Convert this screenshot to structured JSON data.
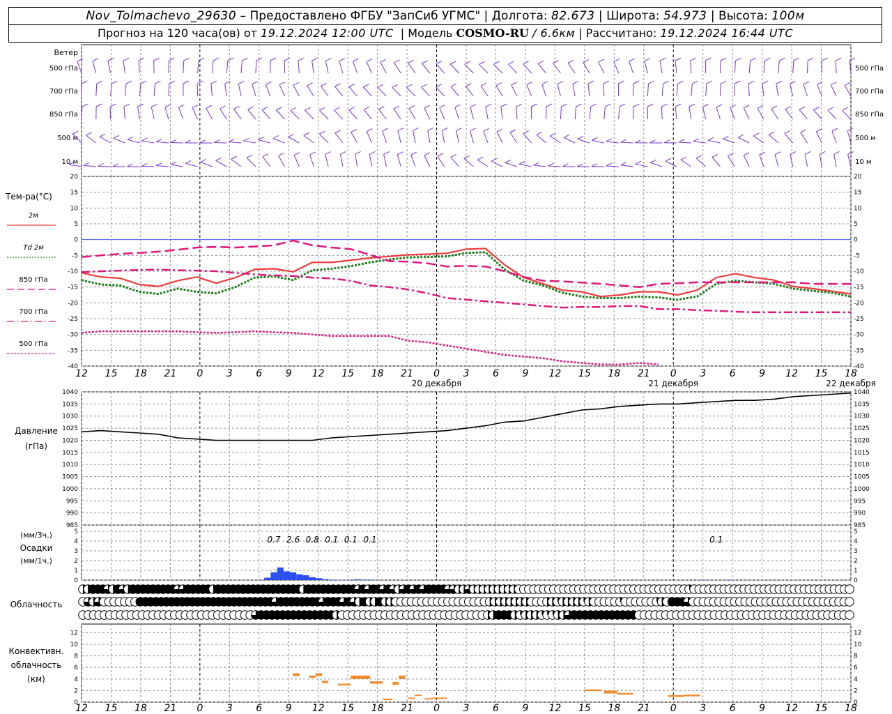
{
  "header": {
    "station": "Nov_Tolmachevo_29630",
    "dash": "–",
    "provider": "Предоставлено ФГБУ \"ЗапСиб УГМС\"",
    "lon_label": "Долгота:",
    "lon_value": "82.673",
    "lat_label": "Широта:",
    "lat_value": "54.973",
    "height_label": "Высота:",
    "height_value": "100м",
    "forecast_label": "Прогноз на 120 часа(ов) от",
    "forecast_start": "19.12.2024 12:00 UTC",
    "model_label": "Модель",
    "model_name": "COSMO-RU",
    "model_res": "/ 6.6км",
    "calc_label": "Рассчитано:",
    "calc_time": "19.12.2024 16:44 UTC"
  },
  "time_axis": {
    "hour_labels": [
      "12",
      "15",
      "18",
      "21",
      "0",
      "3",
      "6",
      "9",
      "12",
      "15",
      "18",
      "21",
      "0",
      "3",
      "6",
      "9",
      "12",
      "15",
      "18",
      "21",
      "0",
      "3",
      "6",
      "9",
      "12",
      "15",
      "18"
    ],
    "day_labels": [
      {
        "label": "20 декабря",
        "hour_index": 12
      },
      {
        "label": "21 декабря",
        "hour_index": 20
      },
      {
        "label": "22 декабря",
        "hour_index": 26
      }
    ]
  },
  "colors": {
    "wind": "#7a2fd0",
    "t2m": "#ee3a3a",
    "td2m": "#1a7a1a",
    "t850": "#e0157e",
    "t700": "#e0157e",
    "t500": "#e0157e",
    "pressure": "#000000",
    "precip": "#2b4ef5",
    "convective": "#f08c30",
    "zero_line": "#4a64ff",
    "grid": "#909090"
  },
  "wind_panel": {
    "title": "Ветер",
    "levels": [
      "500 гПа",
      "700 гПа",
      "850 гПа",
      "500 м",
      "10  м"
    ]
  },
  "temp_panel": {
    "title": "Тем-ра(°C)",
    "legend": [
      {
        "label": "2м",
        "style": "solid"
      },
      {
        "label": "Td  2м",
        "style": "dotted"
      },
      {
        "label": "850 гПа",
        "style": "dash"
      },
      {
        "label": "700 гПа",
        "style": "dashdot"
      },
      {
        "label": "500 гПа",
        "style": "dot"
      }
    ],
    "ylim": [
      -40,
      20
    ],
    "ticks": [
      20,
      15,
      10,
      5,
      0,
      -5,
      -10,
      -15,
      -20,
      -25,
      -30,
      -35,
      -40
    ]
  },
  "pressure_panel": {
    "title": "Давление",
    "unit": "(гПа)",
    "ylim": [
      985,
      1040
    ],
    "ticks": [
      1040,
      1035,
      1030,
      1025,
      1020,
      1015,
      1010,
      1005,
      1000,
      995,
      990,
      985
    ]
  },
  "precip_panel": {
    "unit3h": "(мм/3ч.)",
    "title": "Осадки",
    "unit1h": "(мм/1ч.)",
    "ylim": [
      0,
      5
    ],
    "ticks": [
      5,
      4,
      3,
      2,
      1,
      0
    ],
    "totals": [
      {
        "hour": 30,
        "value": "0.7"
      },
      {
        "hour": 33,
        "value": "2.6"
      },
      {
        "hour": 36,
        "value": "0.8"
      },
      {
        "hour": 39,
        "value": "0.1"
      },
      {
        "hour": 42,
        "value": "0.1"
      },
      {
        "hour": 45,
        "value": "0.1"
      },
      {
        "hour": 99,
        "value": "0.1"
      }
    ]
  },
  "cloud_panel": {
    "title": "Облачность"
  },
  "conv_panel": {
    "title_line1": "Конвективн.",
    "title_line2": "облачность",
    "unit": "(км)",
    "ylim": [
      0,
      13
    ],
    "ticks": [
      12,
      10,
      8,
      6,
      4,
      2,
      0
    ]
  },
  "chart_data": [
    {
      "type": "line",
      "title": "Тем-ра(°C)",
      "x_hours": [
        0,
        3,
        6,
        9,
        12,
        15,
        18,
        21,
        24,
        27,
        30,
        33,
        36,
        39,
        42,
        45,
        48,
        51,
        54,
        57,
        60,
        63,
        66,
        69,
        72,
        75,
        78,
        81,
        84,
        87,
        90,
        93,
        96,
        99,
        102,
        105,
        108,
        111,
        114,
        117,
        120
      ],
      "series": [
        {
          "name": "2м",
          "values": [
            -10.5,
            -11.8,
            -12.2,
            -14.2,
            -14.8,
            -13.0,
            -11.8,
            -13.8,
            -12.0,
            -9.4,
            -9.2,
            -10.2,
            -7.2,
            -7.2,
            -6.5,
            -5.8,
            -5.3,
            -4.8,
            -4.6,
            -4.3,
            -3.0,
            -2.8,
            -8.0,
            -12.0,
            -14.0,
            -16.0,
            -16.5,
            -18.0,
            -17.5,
            -16.5,
            -16.5,
            -17.5,
            -16.0,
            -12.0,
            -10.8,
            -12.0,
            -12.8,
            -14.8,
            -15.5,
            -16.3,
            -17.2
          ]
        },
        {
          "name": "Td  2м",
          "values": [
            -12.8,
            -14.2,
            -14.5,
            -16.5,
            -17.2,
            -15.5,
            -16.5,
            -17.0,
            -15.0,
            -12.0,
            -11.6,
            -12.8,
            -9.7,
            -9.2,
            -8.4,
            -7.2,
            -6.3,
            -5.6,
            -5.5,
            -5.3,
            -4.2,
            -4.0,
            -9.5,
            -13.0,
            -14.5,
            -16.8,
            -18.0,
            -18.5,
            -18.5,
            -18.0,
            -18.3,
            -19.0,
            -18.0,
            -14.0,
            -13.0,
            -13.5,
            -14.0,
            -15.5,
            -16.2,
            -16.8,
            -18.0
          ]
        },
        {
          "name": "850 гПа",
          "values": [
            -5.5,
            -5.0,
            -4.5,
            -4.2,
            -3.8,
            -3.2,
            -2.5,
            -2.3,
            -2.5,
            -2.2,
            -1.8,
            -0.3,
            -1.8,
            -2.5,
            -3.0,
            -4.8,
            -6.8,
            -7.0,
            -7.5,
            -8.5,
            -8.3,
            -8.5,
            -10.0,
            -11.8,
            -13.0,
            -13.2,
            -13.6,
            -14.0,
            -14.5,
            -15.0,
            -14.0,
            -13.8,
            -13.5,
            -13.5,
            -13.5,
            -13.5,
            -13.5,
            -13.5,
            -14.0,
            -14.0,
            -14.0
          ]
        },
        {
          "name": "700 гПа",
          "values": [
            -10.3,
            -10.0,
            -9.8,
            -9.6,
            -9.5,
            -9.7,
            -9.8,
            -10.0,
            -10.5,
            -11.0,
            -11.3,
            -11.5,
            -12.0,
            -12.3,
            -13.0,
            -14.5,
            -15.0,
            -15.8,
            -17.0,
            -18.5,
            -19.0,
            -19.5,
            -20.0,
            -20.5,
            -21.0,
            -21.5,
            -21.3,
            -21.3,
            -21.0,
            -21.0,
            -22.0,
            -22.0,
            -22.3,
            -22.5,
            -22.8,
            -23.0,
            -23.0,
            -23.0,
            -23.0,
            -23.0,
            -23.0
          ]
        },
        {
          "name": "500 гПа",
          "values": [
            -29.5,
            -29.0,
            -29.0,
            -29.0,
            -29.0,
            -29.0,
            -29.3,
            -29.5,
            -29.3,
            -29.0,
            -29.3,
            -29.5,
            -30.0,
            -30.5,
            -30.5,
            -30.5,
            -30.5,
            -32.0,
            -32.5,
            -33.5,
            -34.5,
            -35.5,
            -36.5,
            -37.0,
            -37.5,
            -38.5,
            -39.0,
            -39.5,
            -39.5,
            -39.0,
            -39.5,
            -40.5,
            -41.0,
            -41.0,
            -41.0,
            -41.0,
            -41.0,
            -41.0,
            -41.0,
            -41.0,
            -41.0
          ]
        }
      ]
    },
    {
      "type": "line",
      "title": "Давление",
      "ylabel": "(гПа)",
      "x_hours": [
        0,
        3,
        6,
        9,
        12,
        15,
        18,
        21,
        24,
        27,
        30,
        33,
        36,
        39,
        42,
        45,
        48,
        51,
        54,
        57,
        60,
        63,
        66,
        69,
        72,
        75,
        78,
        81,
        84,
        87,
        90,
        93,
        96,
        99,
        102,
        105,
        108,
        111,
        114,
        117,
        120
      ],
      "series": [
        {
          "name": "Давление",
          "values": [
            1023.5,
            1024.0,
            1023.5,
            1023.0,
            1022.5,
            1021.0,
            1020.5,
            1020.0,
            1020.0,
            1020.0,
            1020.0,
            1020.0,
            1020.0,
            1021.0,
            1021.5,
            1022.0,
            1022.5,
            1023.0,
            1023.5,
            1024.0,
            1025.0,
            1026.0,
            1027.5,
            1028.0,
            1029.5,
            1031.0,
            1032.5,
            1033.0,
            1034.0,
            1034.5,
            1035.0,
            1035.0,
            1035.5,
            1036.0,
            1036.5,
            1036.5,
            1037.0,
            1038.0,
            1038.5,
            1039.0,
            1039.5
          ]
        }
      ]
    },
    {
      "type": "bar",
      "title": "Осадки",
      "ylabel": "(мм/1ч.)",
      "x_hours": [
        28,
        29,
        30,
        31,
        32,
        33,
        34,
        35,
        36,
        37,
        38,
        39,
        40,
        41,
        42,
        43,
        44,
        45,
        46,
        97,
        101
      ],
      "values": [
        0.05,
        0.25,
        0.8,
        1.3,
        0.9,
        0.8,
        0.6,
        0.5,
        0.3,
        0.2,
        0.1,
        0.05,
        0.03,
        0.02,
        0.05,
        0.08,
        0.05,
        0.05,
        0.02,
        0.05,
        0.05
      ]
    },
    {
      "type": "table",
      "title": "Облачность",
      "layers_octas": [
        [
          4,
          4,
          8,
          8,
          8,
          6,
          4,
          8,
          6,
          4,
          8,
          8,
          8,
          8,
          8,
          8,
          8,
          8,
          8,
          6,
          6,
          8,
          8,
          8,
          8,
          8,
          4,
          8,
          8,
          8,
          8,
          8,
          8,
          8,
          8,
          8,
          8,
          8,
          8,
          8,
          8,
          8,
          8,
          8,
          4,
          8,
          8,
          8,
          8,
          8,
          8,
          8,
          8,
          8,
          8,
          6,
          8,
          6,
          8,
          8,
          6,
          8,
          6,
          4,
          6,
          8,
          6,
          8,
          6,
          8,
          8,
          8,
          8,
          6,
          6,
          4,
          4,
          6,
          4,
          4,
          4,
          4,
          4,
          4,
          4,
          4,
          4,
          0,
          0,
          0,
          0,
          0,
          0,
          0,
          0,
          0,
          0,
          0,
          0,
          0,
          0,
          0,
          0,
          0,
          0,
          0,
          0,
          0,
          0,
          0,
          0,
          0,
          0,
          0,
          0,
          0,
          0,
          0,
          0,
          0,
          0,
          2,
          0,
          0,
          0,
          0,
          0,
          0,
          0,
          0,
          0,
          0,
          0,
          0,
          0,
          0,
          0,
          0,
          0,
          0,
          0,
          0,
          0,
          0,
          0,
          0,
          0,
          0,
          0,
          0,
          0,
          0,
          0,
          0
        ],
        [
          0,
          6,
          4,
          6,
          0,
          0,
          0,
          0,
          0,
          0,
          0,
          8,
          8,
          8,
          8,
          8,
          8,
          8,
          8,
          8,
          8,
          8,
          8,
          8,
          8,
          8,
          8,
          8,
          8,
          8,
          8,
          8,
          8,
          8,
          8,
          8,
          8,
          6,
          8,
          8,
          8,
          8,
          8,
          8,
          8,
          8,
          6,
          8,
          8,
          8,
          6,
          8,
          6,
          4,
          8,
          4,
          4,
          8,
          4,
          4,
          0,
          0,
          0,
          0,
          0,
          0,
          0,
          0,
          0,
          0,
          0,
          0,
          0,
          0,
          0,
          0,
          0,
          0,
          4,
          4,
          4,
          4,
          4,
          4,
          4,
          4,
          0,
          0,
          0,
          4,
          4,
          2,
          4,
          4,
          4,
          4,
          2,
          4,
          0,
          0,
          0,
          0,
          0,
          2,
          0,
          0,
          0,
          0,
          0,
          0,
          2,
          4,
          0,
          8,
          8,
          8,
          6,
          0,
          0,
          0,
          0,
          0,
          0,
          0,
          0,
          0,
          0,
          0,
          0,
          0,
          0,
          0,
          0,
          0,
          0,
          0,
          0,
          0,
          0,
          0,
          0,
          0,
          0,
          0,
          0,
          0,
          0,
          0
        ],
        [
          0,
          0,
          0,
          0,
          0,
          0,
          0,
          0,
          0,
          0,
          0,
          0,
          0,
          0,
          0,
          0,
          0,
          0,
          0,
          0,
          0,
          0,
          0,
          0,
          0,
          0,
          0,
          0,
          0,
          0,
          0,
          0,
          6,
          8,
          8,
          8,
          8,
          8,
          8,
          8,
          8,
          8,
          8,
          8,
          8,
          8,
          8,
          4,
          0,
          0,
          0,
          0,
          0,
          0,
          0,
          0,
          0,
          0,
          0,
          0,
          0,
          0,
          0,
          0,
          0,
          0,
          0,
          0,
          0,
          0,
          0,
          0,
          0,
          0,
          0,
          4,
          4,
          8,
          8,
          8,
          4,
          2,
          4,
          4,
          4,
          2,
          2,
          2,
          4,
          4,
          6,
          8,
          8,
          8,
          8,
          8,
          8,
          8,
          8,
          8,
          8,
          8,
          8,
          0,
          0,
          0,
          0,
          0,
          0,
          0,
          0,
          0,
          0,
          0,
          0,
          0,
          0,
          0,
          0,
          0,
          0,
          0,
          0,
          0,
          0,
          0,
          0,
          0,
          0,
          0,
          0,
          0,
          0,
          0,
          0,
          0,
          0,
          0,
          0,
          0,
          0,
          0,
          0
        ]
      ]
    },
    {
      "type": "bar",
      "title": "Конвективн. облачность",
      "ylabel": "(км)",
      "segments": [
        {
          "x0": 33.0,
          "x1": 34.0,
          "bottom": 4.5,
          "top": 5.0
        },
        {
          "x0": 35.5,
          "x1": 36.5,
          "bottom": 4.2,
          "top": 4.6
        },
        {
          "x0": 36.5,
          "x1": 37.5,
          "bottom": 4.5,
          "top": 5.0
        },
        {
          "x0": 37.5,
          "x1": 38.5,
          "bottom": 3.3,
          "top": 3.7
        },
        {
          "x0": 40.0,
          "x1": 42.0,
          "bottom": 2.9,
          "top": 3.2
        },
        {
          "x0": 42.0,
          "x1": 43.0,
          "bottom": 4.0,
          "top": 4.6
        },
        {
          "x0": 43.0,
          "x1": 45.0,
          "bottom": 4.0,
          "top": 4.6
        },
        {
          "x0": 45.0,
          "x1": 47.0,
          "bottom": 3.2,
          "top": 3.6
        },
        {
          "x0": 47.0,
          "x1": 48.5,
          "bottom": 0.5,
          "top": 0.6
        },
        {
          "x0": 48.5,
          "x1": 49.5,
          "bottom": 3.0,
          "top": 3.5
        },
        {
          "x0": 49.5,
          "x1": 50.5,
          "bottom": 4.0,
          "top": 4.6
        },
        {
          "x0": 51.0,
          "x1": 52.0,
          "bottom": 0.7,
          "top": 0.8
        },
        {
          "x0": 52.0,
          "x1": 53.0,
          "bottom": 1.1,
          "top": 1.3
        },
        {
          "x0": 53.5,
          "x1": 54.5,
          "bottom": 0.6,
          "top": 0.7
        },
        {
          "x0": 54.5,
          "x1": 57.0,
          "bottom": 0.6,
          "top": 0.8
        },
        {
          "x0": 78.5,
          "x1": 81.0,
          "bottom": 1.9,
          "top": 2.2
        },
        {
          "x0": 81.5,
          "x1": 83.5,
          "bottom": 1.5,
          "top": 2.0
        },
        {
          "x0": 83.5,
          "x1": 86.0,
          "bottom": 1.3,
          "top": 1.6
        },
        {
          "x0": 91.5,
          "x1": 94.0,
          "bottom": 0.9,
          "top": 1.2
        },
        {
          "x0": 94.0,
          "x1": 96.5,
          "bottom": 1.0,
          "top": 1.3
        }
      ]
    }
  ]
}
